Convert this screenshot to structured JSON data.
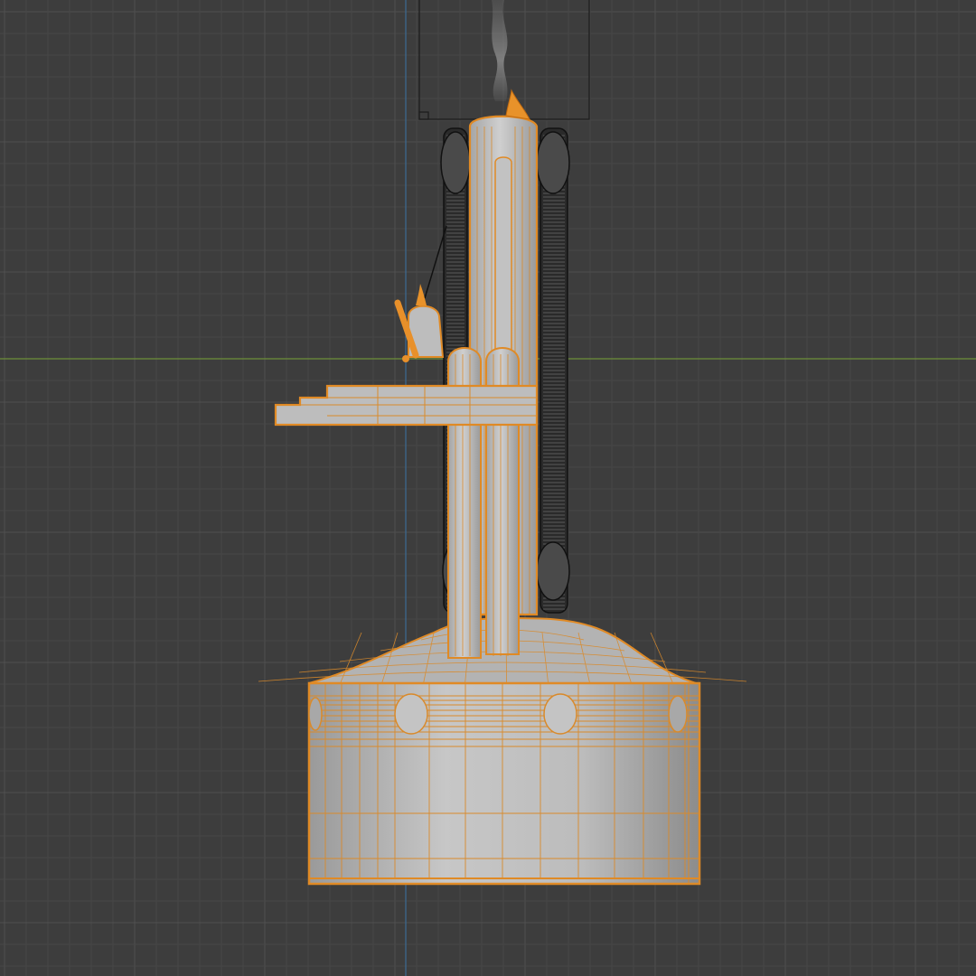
{
  "viewport": {
    "view": "front-orthographic",
    "shading": "solid-with-wireframe-overlay",
    "colors": {
      "background": "#3d3d3d",
      "grid_minor": "#474747",
      "grid_major": "#505050",
      "axis_x": "#6e8f3a",
      "axis_z": "#3b6a94",
      "selection_outline": "#e8902a",
      "wire_selected": "#d98a2b",
      "wire_unselected": "#111111",
      "solid": "#b9b9b9"
    }
  },
  "scene": {
    "objects": [
      {
        "name": "base-cylinder",
        "selected": true
      },
      {
        "name": "base-dome",
        "selected": true
      },
      {
        "name": "main-column",
        "selected": true
      },
      {
        "name": "side-pipes",
        "selected": true
      },
      {
        "name": "platform-slab",
        "selected": true
      },
      {
        "name": "lever-figure",
        "selected": true
      },
      {
        "name": "chain-belts",
        "selected": false
      },
      {
        "name": "camera-frame",
        "selected": false
      },
      {
        "name": "smoke-plume",
        "selected": false
      }
    ]
  }
}
